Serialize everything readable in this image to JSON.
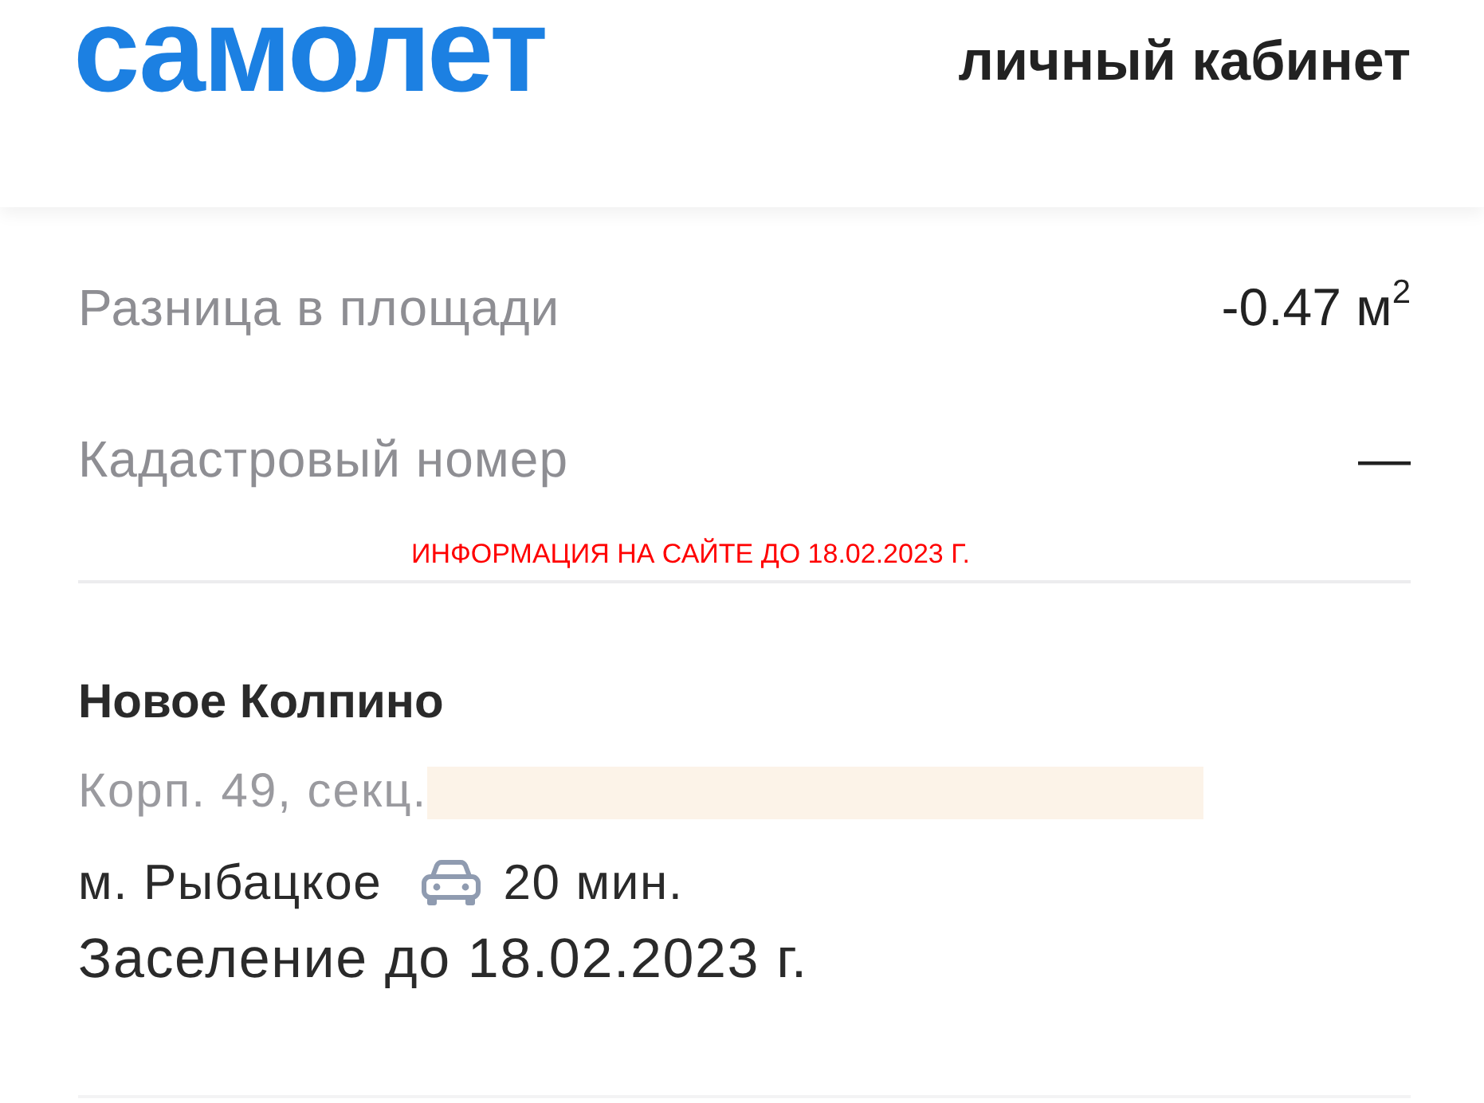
{
  "header": {
    "logo": "самолет",
    "title": "личный кабинет"
  },
  "details": [
    {
      "label": "Разница в площади",
      "value": "-0.47 м$^{2}$"
    },
    {
      "label": "Кадастровый номер",
      "value": "—"
    }
  ],
  "annotation": "ИНФОРМАЦИЯ НА САЙТЕ ДО 18.02.2023 Г.",
  "project": {
    "name": "Новое Колпино",
    "address": "Корп. 49, секц.",
    "metro": "м. Рыбацкое",
    "travel_time": "20 мин.",
    "move_in": "Заселение до 18.02.2023 г."
  }
}
